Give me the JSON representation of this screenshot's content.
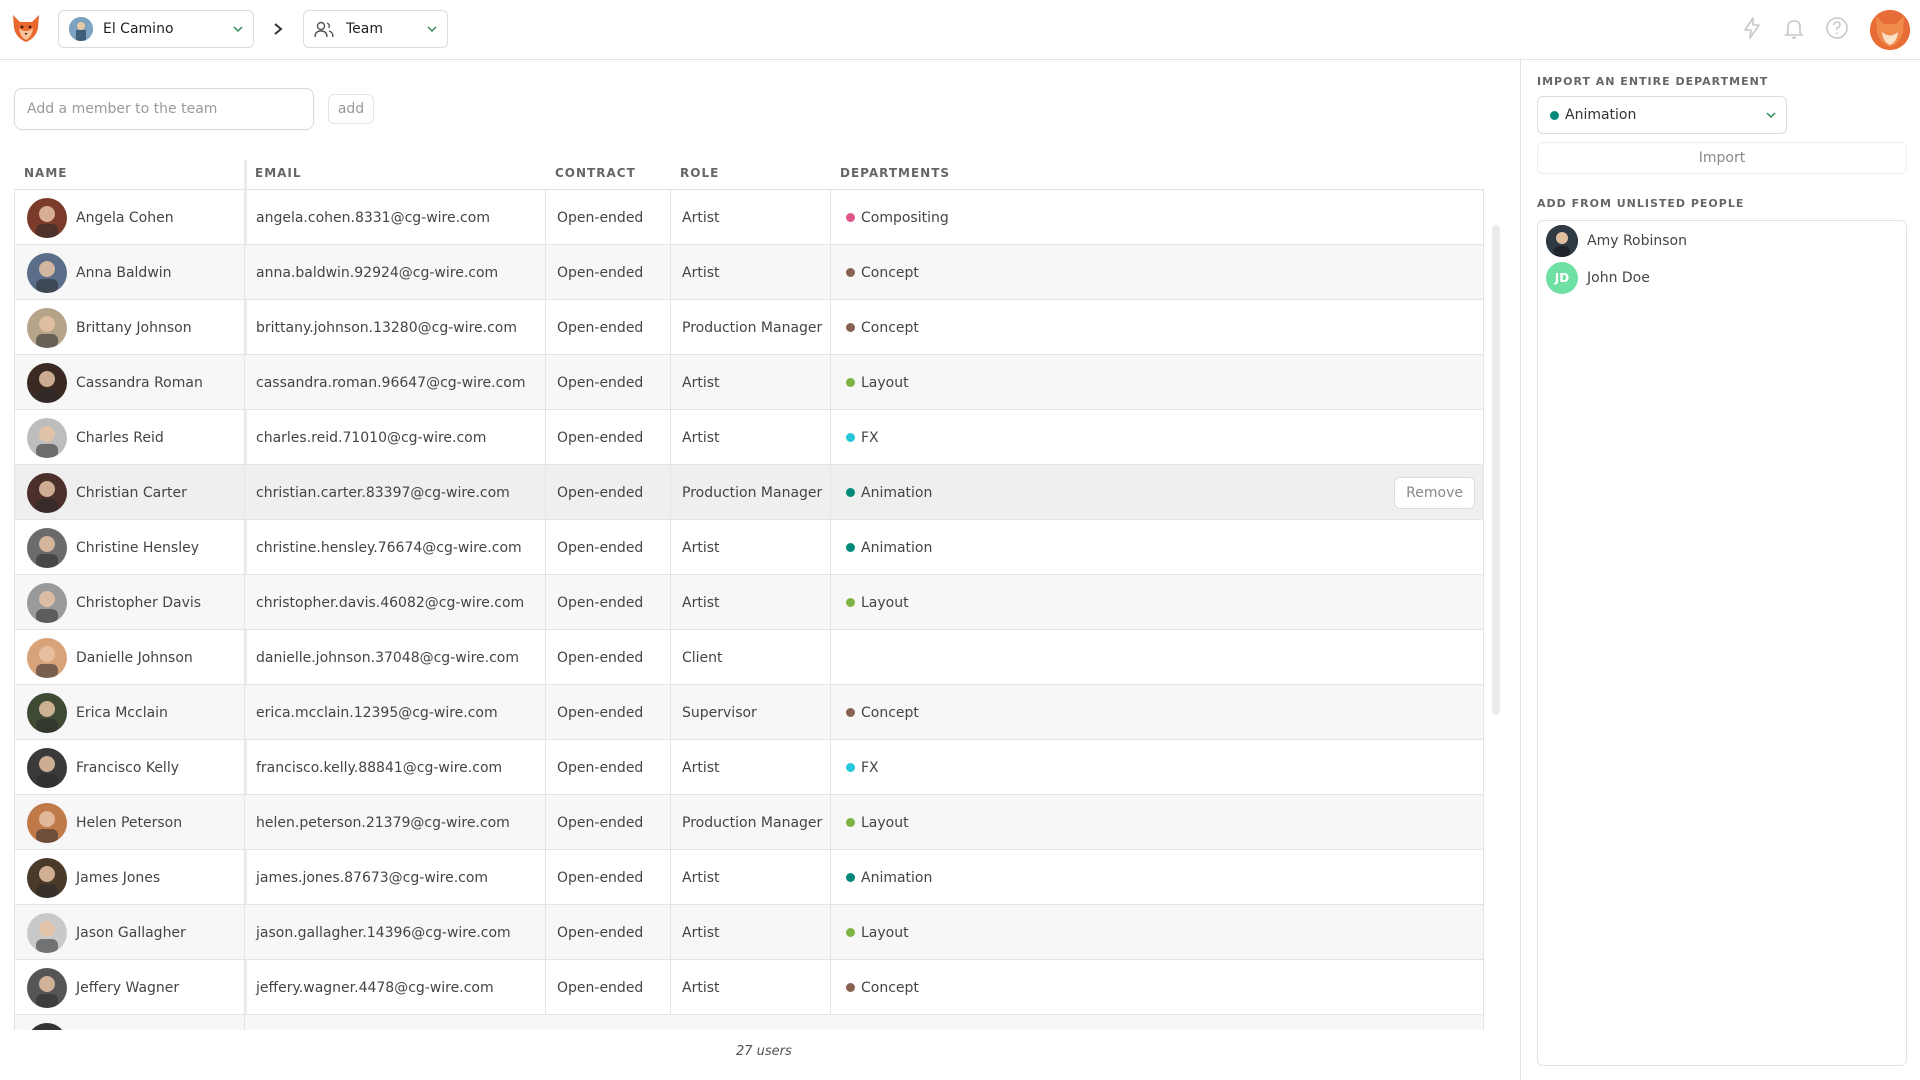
{
  "header": {
    "production": "El Camino",
    "section": "Team"
  },
  "main": {
    "add_member_placeholder": "Add a member to the team",
    "add_label": "add",
    "columns": [
      "NAME",
      "EMAIL",
      "CONTRACT",
      "ROLE",
      "DEPARTMENTS"
    ],
    "remove_label": "Remove",
    "rows": [
      {
        "name": "Angela Cohen",
        "email": "angela.cohen.8331@cg-wire.com",
        "contract": "Open-ended",
        "role": "Artist",
        "department": "Compositing",
        "dept_color": "#e0558a",
        "avatar_color": "#7a3b2a"
      },
      {
        "name": "Anna Baldwin",
        "email": "anna.baldwin.92924@cg-wire.com",
        "contract": "Open-ended",
        "role": "Artist",
        "department": "Concept",
        "dept_color": "#8a6151",
        "avatar_color": "#5a6e8a"
      },
      {
        "name": "Brittany Johnson",
        "email": "brittany.johnson.13280@cg-wire.com",
        "contract": "Open-ended",
        "role": "Production Manager",
        "department": "Concept",
        "dept_color": "#8a6151",
        "avatar_color": "#b5a48a"
      },
      {
        "name": "Cassandra Roman",
        "email": "cassandra.roman.96647@cg-wire.com",
        "contract": "Open-ended",
        "role": "Artist",
        "department": "Layout",
        "dept_color": "#7cb342",
        "avatar_color": "#3b2a24"
      },
      {
        "name": "Charles Reid",
        "email": "charles.reid.71010@cg-wire.com",
        "contract": "Open-ended",
        "role": "Artist",
        "department": "FX",
        "dept_color": "#26c6da",
        "avatar_color": "#bdbdbd"
      },
      {
        "name": "Christian Carter",
        "email": "christian.carter.83397@cg-wire.com",
        "contract": "Open-ended",
        "role": "Production Manager",
        "department": "Animation",
        "dept_color": "#00897b",
        "avatar_color": "#4a2f2a"
      },
      {
        "name": "Christine Hensley",
        "email": "christine.hensley.76674@cg-wire.com",
        "contract": "Open-ended",
        "role": "Artist",
        "department": "Animation",
        "dept_color": "#00897b",
        "avatar_color": "#6b6b6b"
      },
      {
        "name": "Christopher Davis",
        "email": "christopher.davis.46082@cg-wire.com",
        "contract": "Open-ended",
        "role": "Artist",
        "department": "Layout",
        "dept_color": "#7cb342",
        "avatar_color": "#9a9a9a"
      },
      {
        "name": "Danielle Johnson",
        "email": "danielle.johnson.37048@cg-wire.com",
        "contract": "Open-ended",
        "role": "Client",
        "department": "",
        "dept_color": "",
        "avatar_color": "#d9a37a"
      },
      {
        "name": "Erica Mcclain",
        "email": "erica.mcclain.12395@cg-wire.com",
        "contract": "Open-ended",
        "role": "Supervisor",
        "department": "Concept",
        "dept_color": "#8a6151",
        "avatar_color": "#3e4a33"
      },
      {
        "name": "Francisco Kelly",
        "email": "francisco.kelly.88841@cg-wire.com",
        "contract": "Open-ended",
        "role": "Artist",
        "department": "FX",
        "dept_color": "#26c6da",
        "avatar_color": "#3a3a3a"
      },
      {
        "name": "Helen Peterson",
        "email": "helen.peterson.21379@cg-wire.com",
        "contract": "Open-ended",
        "role": "Production Manager",
        "department": "Layout",
        "dept_color": "#7cb342",
        "avatar_color": "#c07a4a"
      },
      {
        "name": "James Jones",
        "email": "james.jones.87673@cg-wire.com",
        "contract": "Open-ended",
        "role": "Artist",
        "department": "Animation",
        "dept_color": "#00897b",
        "avatar_color": "#4a3a2a"
      },
      {
        "name": "Jason Gallagher",
        "email": "jason.gallagher.14396@cg-wire.com",
        "contract": "Open-ended",
        "role": "Artist",
        "department": "Layout",
        "dept_color": "#7cb342",
        "avatar_color": "#c9c9c9"
      },
      {
        "name": "Jeffery Wagner",
        "email": "jeffery.wagner.4478@cg-wire.com",
        "contract": "Open-ended",
        "role": "Artist",
        "department": "Concept",
        "dept_color": "#8a6151",
        "avatar_color": "#555555"
      }
    ],
    "user_count": "27 users"
  },
  "side": {
    "import_title": "IMPORT AN ENTIRE DEPARTMENT",
    "selected_department": "Animation",
    "selected_department_color": "#00897b",
    "import_label": "Import",
    "unlisted_title": "ADD FROM UNLISTED PEOPLE",
    "unlisted": [
      {
        "name": "Amy Robinson",
        "initials": "",
        "avatar_color": "#2f3a44"
      },
      {
        "name": "John Doe",
        "initials": "JD",
        "avatar_color": "#6fe0a4"
      }
    ]
  }
}
